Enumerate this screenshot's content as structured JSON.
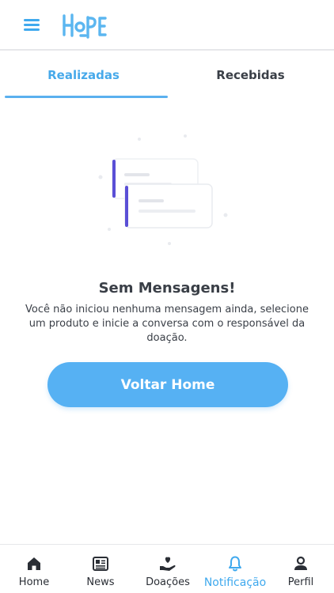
{
  "header": {
    "logo_text": "HoPE",
    "menu_icon": "hamburger-menu-icon"
  },
  "tabs": [
    {
      "label": "Realizadas",
      "active": true
    },
    {
      "label": "Recebidas",
      "active": false
    }
  ],
  "empty_state": {
    "title": "Sem Mensagens!",
    "description": "Você não iniciou nenhuma mensagem ainda, selecione um produto e inicie a conversa com o responsável da doação."
  },
  "primary_button": {
    "label": "Voltar Home"
  },
  "bottom_nav": {
    "items": [
      {
        "label": "Home",
        "icon": "home-icon",
        "active": false
      },
      {
        "label": "News",
        "icon": "news-icon",
        "active": false
      },
      {
        "label": "Doações",
        "icon": "donation-hand-heart-icon",
        "active": false
      },
      {
        "label": "Notificação",
        "icon": "bell-icon",
        "active": true
      },
      {
        "label": "Perfil",
        "icon": "user-icon",
        "active": false
      }
    ]
  },
  "colors": {
    "accent": "#47a9ea",
    "button": "#56b1f3",
    "text": "#3a3f47",
    "illustration_accent": "#5a4fd6"
  }
}
